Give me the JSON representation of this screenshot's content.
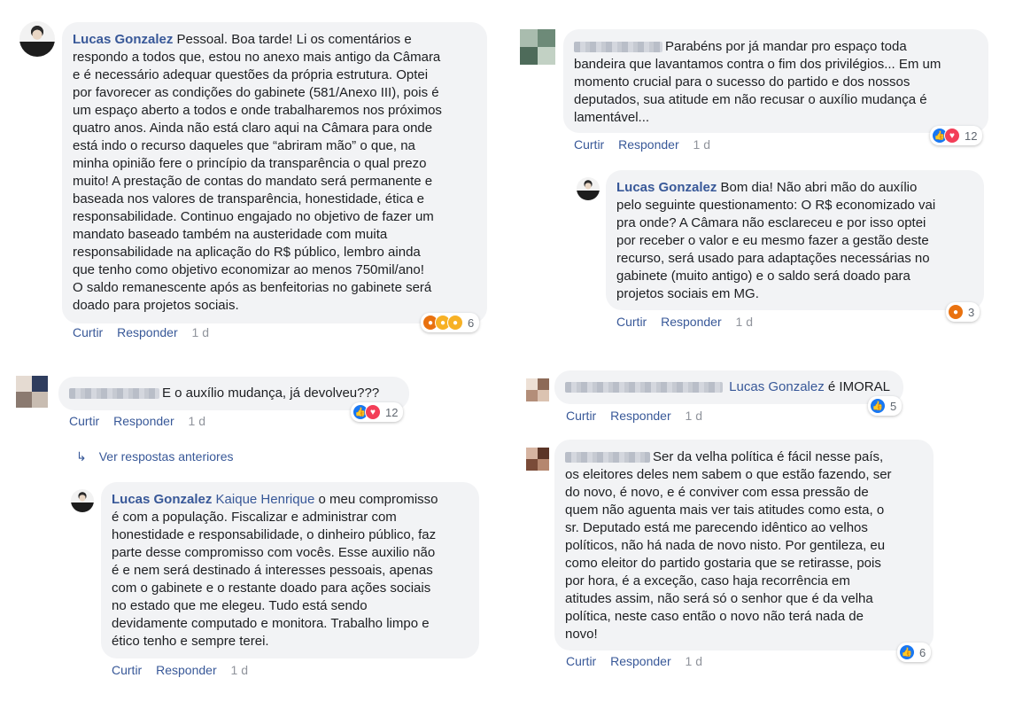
{
  "actions": {
    "like": "Curtir",
    "reply": "Responder"
  },
  "c1": {
    "author": "Lucas Gonzalez",
    "lines": [
      "Pessoal. Boa tarde! Li os comentários e",
      "respondo a todos que, estou no anexo mais antigo da Câmara",
      "e é necessário adequar questões da própria estrutura. Optei",
      "por favorecer as condições do gabinete (581/Anexo III), pois é",
      "um espaço aberto a todos e onde trabalharemos nos próximos",
      "quatro anos. Ainda não está claro aqui na Câmara para onde",
      "está indo o recurso daqueles que “abriram mão” o que, na",
      "minha opinião fere o princípio da transparência o qual prezo",
      "muito! A prestação de contas do mandato será permanente e",
      "baseada nos valores de transparência, honestidade, ética e",
      "responsabilidade. Continuo engajado no objetivo de fazer um",
      "mandato baseado também na austeridade com muita",
      "responsabilidade na aplicação do R$ público, lembro ainda",
      "que tenho como objetivo economizar ao menos 750mil/ano!",
      "O saldo remanescente após as benfeitorias no gabinete será",
      "doado para projetos sociais."
    ],
    "time": "1 d",
    "reactions": "6"
  },
  "c2": {
    "text": "E o auxílio mudança, já devolveu???",
    "time": "1 d",
    "reactions": "12"
  },
  "more_replies": "Ver respostas anteriores",
  "c3": {
    "author": "Lucas Gonzalez",
    "mention": "Kaique Henrique",
    "lines": [
      "o meu compromisso",
      "é com a população. Fiscalizar e administrar com",
      "honestidade e responsabilidade, o dinheiro público, faz",
      "parte desse compromisso com vocês. Esse auxilio não",
      "é e nem será destinado á interesses pessoais, apenas",
      "com o gabinete e o restante doado para ações sociais",
      "no estado que me elegeu. Tudo está sendo",
      "devidamente computado e monitora. Trabalho limpo e",
      "ético tenho e sempre terei."
    ],
    "time": "1 d"
  },
  "c4": {
    "lines": [
      "Parabéns por já mandar pro espaço toda",
      "bandeira que lavantamos contra o fim dos privilégios... Em um",
      "momento crucial para o sucesso do partido e dos nossos",
      "deputados, sua atitude em não recusar o auxílio mudança é",
      "lamentável..."
    ],
    "time": "1 d",
    "reactions": "12"
  },
  "c5": {
    "author": "Lucas Gonzalez",
    "lines": [
      "Bom dia! Não abri mão do auxílio",
      "pelo seguinte questionamento: O R$ economizado vai",
      "pra onde? A Câmara não esclareceu e por isso optei",
      "por receber o valor e eu mesmo fazer a gestão deste",
      "recurso, será usado para adaptações necessárias no",
      "gabinete (muito antigo) e o saldo será doado para",
      "projetos sociais em MG."
    ],
    "time": "1 d",
    "reactions": "3"
  },
  "c6": {
    "mention": "Lucas Gonzalez",
    "text": "é IMORAL",
    "time": "1 d",
    "reactions": "5"
  },
  "c7": {
    "lines": [
      "Ser da velha política é fácil nesse país,",
      "os eleitores deles nem sabem o que estão fazendo, ser",
      "do novo, é novo, e é conviver com essa pressão de",
      "quem não aguenta mais ver tais atitudes como esta, o",
      "sr. Deputado está me parecendo idêntico ao velhos",
      "políticos, não há nada de novo nisto. Por gentileza, eu",
      "como eleitor do partido gostaria que se retirasse, pois",
      "por hora, é a exceção, caso haja recorrência em",
      "atitudes assim, não será só o senhor que é da velha",
      "política, neste caso então o novo não terá nada de",
      "novo!"
    ],
    "time": "1 d",
    "reactions": "6"
  }
}
